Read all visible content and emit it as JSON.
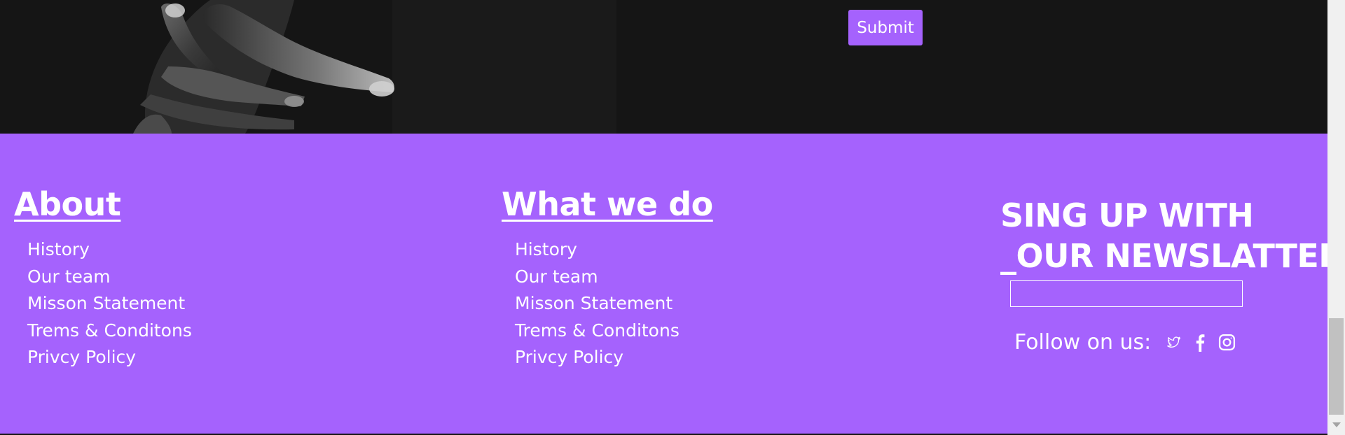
{
  "hero": {
    "submit_label": "Submit"
  },
  "footer": {
    "about": {
      "heading": "About",
      "links": [
        "History",
        "Our team",
        "Misson Statement",
        "Trems & Conditons",
        "Privcy Policy"
      ]
    },
    "what_we_do": {
      "heading": "What we do",
      "links": [
        "History",
        "Our team",
        "Misson Statement",
        "Trems & Conditons",
        "Privcy Policy"
      ]
    },
    "newsletter": {
      "heading_line1": "SING UP WITH",
      "heading_line2": "_OUR NEWSLATTER",
      "email_value": "",
      "follow_label": "Follow on us:",
      "social_icons": [
        "twitter-icon",
        "facebook-icon",
        "instagram-icon"
      ]
    }
  },
  "colors": {
    "accent": "#a562fd",
    "hero_background": "#151515",
    "text": "#ffffff"
  }
}
